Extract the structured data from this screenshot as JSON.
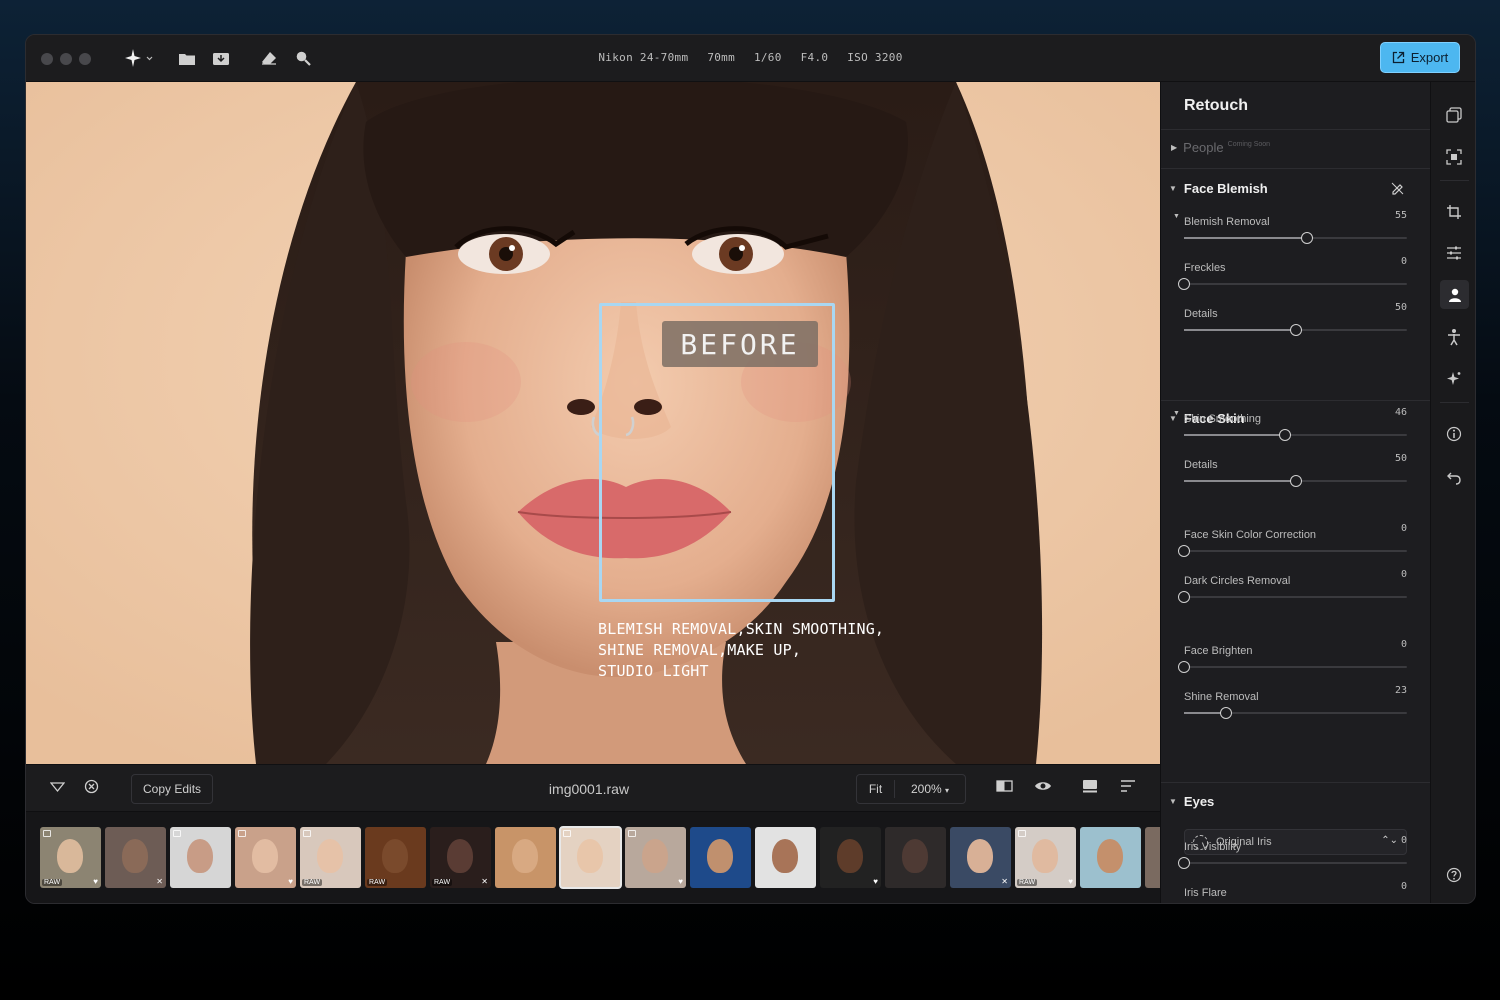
{
  "window": {
    "exif": [
      "Nikon 24-70mm",
      "70mm",
      "1/60",
      "F4.0",
      "ISO 3200"
    ],
    "export_label": "Export"
  },
  "photo": {
    "before_label": "BEFORE",
    "caption_lines": [
      "BLEMISH REMOVAL,SKIN SMOOTHING,",
      "SHINE REMOVAL,MAKE UP,",
      "STUDIO LIGHT"
    ]
  },
  "bottombar": {
    "copy_edits": "Copy Edits",
    "filename": "img0001.raw",
    "fit_label": "Fit",
    "zoom_label": "200%"
  },
  "filmstrip": {
    "thumbs": [
      {
        "bg": "#8c8472",
        "skin": "#d9b89a",
        "raw": "RAW",
        "mark": "♥",
        "tag": true
      },
      {
        "bg": "#6d5c55",
        "skin": "#8a6a58",
        "raw": "",
        "mark": "✕",
        "tag": false
      },
      {
        "bg": "#d6d6d6",
        "skin": "#c89c86",
        "raw": "",
        "mark": "",
        "tag": true
      },
      {
        "bg": "#c9a18a",
        "skin": "#e2bca2",
        "raw": "",
        "mark": "♥",
        "tag": true
      },
      {
        "bg": "#d8c8bc",
        "skin": "#e6c2a8",
        "raw": "RAW",
        "mark": "",
        "tag": true
      },
      {
        "bg": "#6a3a1e",
        "skin": "#7a4a2c",
        "raw": "RAW",
        "mark": "",
        "tag": false
      },
      {
        "bg": "#2a1e1c",
        "skin": "#5a3c34",
        "raw": "RAW",
        "mark": "✕",
        "tag": false
      },
      {
        "bg": "#c89468",
        "skin": "#d8a982",
        "raw": "",
        "mark": "",
        "tag": false
      },
      {
        "bg": "#e4d2c2",
        "skin": "#e8c6aa",
        "raw": "",
        "mark": "",
        "tag": true
      },
      {
        "bg": "#b8a89c",
        "skin": "#caa48c",
        "raw": "",
        "mark": "♥",
        "tag": true
      },
      {
        "bg": "#1e4a8a",
        "skin": "#c0906e",
        "raw": "",
        "mark": "",
        "tag": false
      },
      {
        "bg": "#e2e2e2",
        "skin": "#a87458",
        "raw": "",
        "mark": "",
        "tag": false
      },
      {
        "bg": "#222222",
        "skin": "#5e3c2a",
        "raw": "",
        "mark": "♥",
        "tag": false
      },
      {
        "bg": "#2e2a2a",
        "skin": "#4e3a34",
        "raw": "",
        "mark": "",
        "tag": false
      },
      {
        "bg": "#3a4a64",
        "skin": "#d8b096",
        "raw": "",
        "mark": "✕",
        "tag": false
      },
      {
        "bg": "#d4ccc6",
        "skin": "#e0baa0",
        "raw": "RAW",
        "mark": "♥",
        "tag": true
      },
      {
        "bg": "#9cc0ce",
        "skin": "#c4906c",
        "raw": "",
        "mark": "",
        "tag": false
      },
      {
        "bg": "#7a6a60",
        "skin": "#b08870",
        "raw": "",
        "mark": "",
        "tag": false
      }
    ]
  },
  "panel": {
    "title": "Retouch",
    "people_label": "People",
    "people_badge": "Coming Soon",
    "face_blemish": {
      "title": "Face Blemish",
      "sliders": [
        {
          "label": "Blemish Removal",
          "value": "55",
          "fraction": 0.55,
          "sub": true
        },
        {
          "label": "Freckles",
          "value": "0",
          "fraction": 0,
          "sub": false
        },
        {
          "label": "Details",
          "value": "50",
          "fraction": 0.5,
          "sub": false
        }
      ]
    },
    "face_skin": {
      "title": "Face Skin",
      "sliders": [
        {
          "label": "Skin Smoothing",
          "value": "46",
          "fraction": 0.455,
          "sub": true
        },
        {
          "label": "Details",
          "value": "50",
          "fraction": 0.5,
          "sub": false
        },
        {
          "label": "Face Skin Color Correction",
          "value": "0",
          "fraction": 0,
          "sub": false
        },
        {
          "label": "Dark Circles Removal",
          "value": "0",
          "fraction": 0,
          "sub": false
        },
        {
          "label": "Face Brighten",
          "value": "0",
          "fraction": 0,
          "sub": false
        },
        {
          "label": "Shine Removal",
          "value": "23",
          "fraction": 0.19,
          "sub": false
        }
      ]
    },
    "eyes": {
      "title": "Eyes",
      "dropdown": "Original Iris",
      "sliders": [
        {
          "label": "Iris Visibility",
          "value": "0",
          "fraction": 0,
          "sub": false
        },
        {
          "label": "Iris Flare",
          "value": "0",
          "fraction": 0,
          "sub": false
        }
      ]
    }
  }
}
